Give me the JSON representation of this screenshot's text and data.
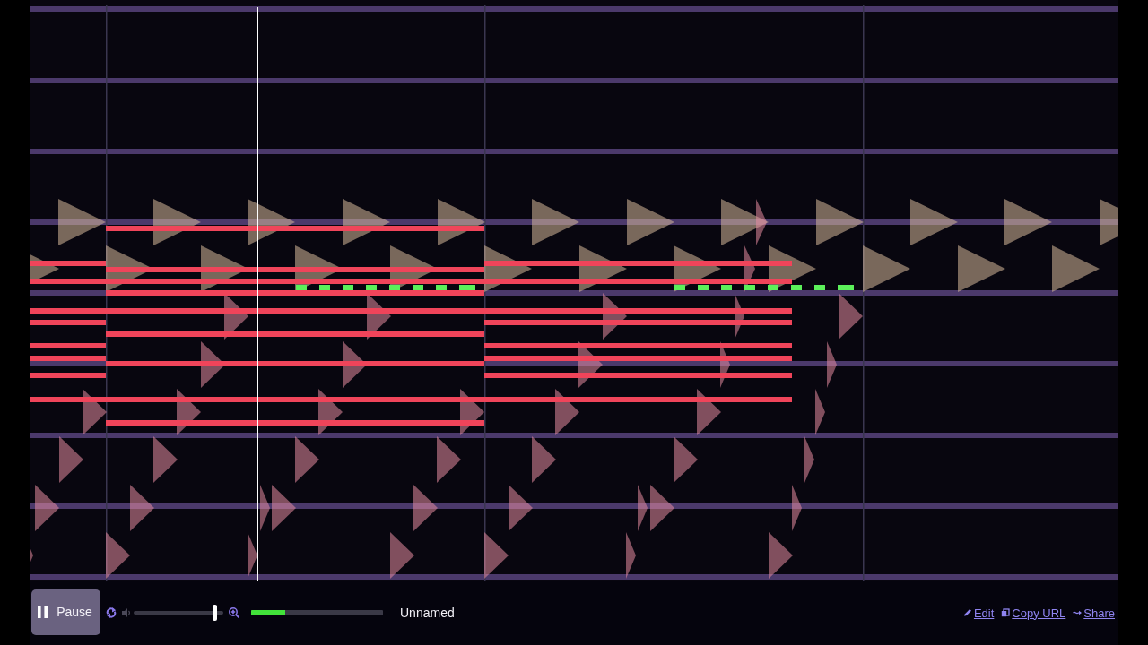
{
  "playback": {
    "label": "Pause",
    "playing": true
  },
  "volume": {
    "level": 0.91
  },
  "timeline": {
    "level": 0.26
  },
  "song_title": "Unnamed",
  "links": [
    {
      "kind": "edit",
      "label": "Edit"
    },
    {
      "kind": "copy",
      "label": "Copy URL"
    },
    {
      "kind": "share",
      "label": "Share"
    }
  ]
}
